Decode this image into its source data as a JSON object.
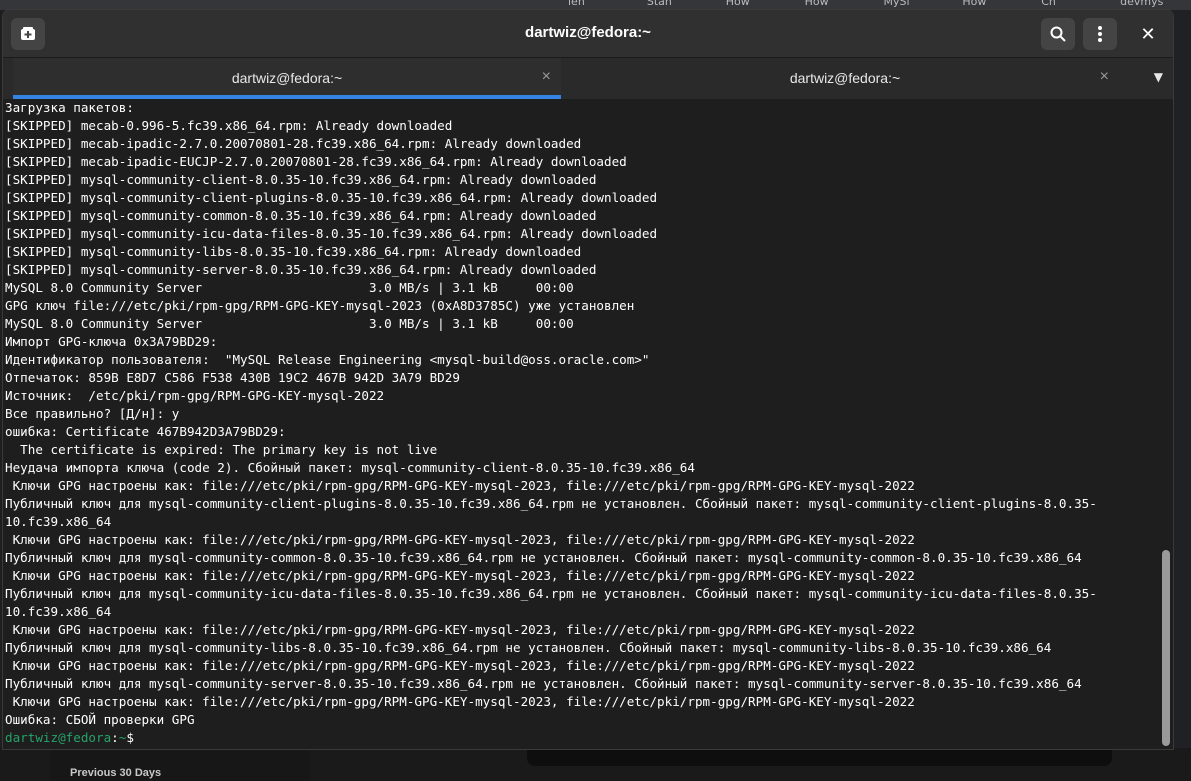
{
  "window": {
    "title": "dartwiz@fedora:~",
    "new_tab_icon": "new-tab-icon",
    "search_icon": "search-icon",
    "menu_icon": "kebab-menu-icon",
    "close_glyph": "✕"
  },
  "tabs": [
    {
      "label": "dartwiz@fedora:~",
      "close": "×",
      "active": true
    },
    {
      "label": "dartwiz@fedora:~",
      "close": "×",
      "active": false
    }
  ],
  "tab_menu_glyph": "▼",
  "background": {
    "browser_tabs": [
      "ien",
      "Stan",
      "How",
      "How",
      "MySi",
      "How",
      "Ch",
      "devmys"
    ],
    "sidebar_label": "Previous 30 Days"
  },
  "terminal": {
    "lines": [
      "Загрузка пакетов:",
      "[SKIPPED] mecab-0.996-5.fc39.x86_64.rpm: Already downloaded",
      "[SKIPPED] mecab-ipadic-2.7.0.20070801-28.fc39.x86_64.rpm: Already downloaded",
      "[SKIPPED] mecab-ipadic-EUCJP-2.7.0.20070801-28.fc39.x86_64.rpm: Already downloaded",
      "[SKIPPED] mysql-community-client-8.0.35-10.fc39.x86_64.rpm: Already downloaded",
      "[SKIPPED] mysql-community-client-plugins-8.0.35-10.fc39.x86_64.rpm: Already downloaded",
      "[SKIPPED] mysql-community-common-8.0.35-10.fc39.x86_64.rpm: Already downloaded",
      "[SKIPPED] mysql-community-icu-data-files-8.0.35-10.fc39.x86_64.rpm: Already downloaded",
      "[SKIPPED] mysql-community-libs-8.0.35-10.fc39.x86_64.rpm: Already downloaded",
      "[SKIPPED] mysql-community-server-8.0.35-10.fc39.x86_64.rpm: Already downloaded",
      "MySQL 8.0 Community Server                      3.0 MB/s | 3.1 kB     00:00",
      "GPG ключ file:///etc/pki/rpm-gpg/RPM-GPG-KEY-mysql-2023 (0xA8D3785C) уже установлен",
      "MySQL 8.0 Community Server                      3.0 MB/s | 3.1 kB     00:00",
      "Импорт GPG-ключа 0x3A79BD29:",
      "Идентификатор пользователя:  \"MySQL Release Engineering <mysql-build@oss.oracle.com>\"",
      "Отпечаток: 859B E8D7 C586 F538 430B 19C2 467B 942D 3A79 BD29",
      "Источник:  /etc/pki/rpm-gpg/RPM-GPG-KEY-mysql-2022",
      "Все правильно? [Д/н]: y",
      "ошибка: Certificate 467B942D3A79BD29:",
      "  The certificate is expired: The primary key is not live",
      "Неудача импорта ключа (code 2). Сбойный пакет: mysql-community-client-8.0.35-10.fc39.x86_64",
      " Ключи GPG настроены как: file:///etc/pki/rpm-gpg/RPM-GPG-KEY-mysql-2023, file:///etc/pki/rpm-gpg/RPM-GPG-KEY-mysql-2022",
      "Публичный ключ для mysql-community-client-plugins-8.0.35-10.fc39.x86_64.rpm не установлен. Сбойный пакет: mysql-community-client-plugins-8.0.35-",
      "10.fc39.x86_64",
      " Ключи GPG настроены как: file:///etc/pki/rpm-gpg/RPM-GPG-KEY-mysql-2023, file:///etc/pki/rpm-gpg/RPM-GPG-KEY-mysql-2022",
      "Публичный ключ для mysql-community-common-8.0.35-10.fc39.x86_64.rpm не установлен. Сбойный пакет: mysql-community-common-8.0.35-10.fc39.x86_64",
      " Ключи GPG настроены как: file:///etc/pki/rpm-gpg/RPM-GPG-KEY-mysql-2023, file:///etc/pki/rpm-gpg/RPM-GPG-KEY-mysql-2022",
      "Публичный ключ для mysql-community-icu-data-files-8.0.35-10.fc39.x86_64.rpm не установлен. Сбойный пакет: mysql-community-icu-data-files-8.0.35-",
      "10.fc39.x86_64",
      " Ключи GPG настроены как: file:///etc/pki/rpm-gpg/RPM-GPG-KEY-mysql-2023, file:///etc/pki/rpm-gpg/RPM-GPG-KEY-mysql-2022",
      "Публичный ключ для mysql-community-libs-8.0.35-10.fc39.x86_64.rpm не установлен. Сбойный пакет: mysql-community-libs-8.0.35-10.fc39.x86_64",
      " Ключи GPG настроены как: file:///etc/pki/rpm-gpg/RPM-GPG-KEY-mysql-2023, file:///etc/pki/rpm-gpg/RPM-GPG-KEY-mysql-2022",
      "Публичный ключ для mysql-community-server-8.0.35-10.fc39.x86_64.rpm не установлен. Сбойный пакет: mysql-community-server-8.0.35-10.fc39.x86_64",
      " Ключи GPG настроены как: file:///etc/pki/rpm-gpg/RPM-GPG-KEY-mysql-2023, file:///etc/pki/rpm-gpg/RPM-GPG-KEY-mysql-2022",
      "Ошибка: СБОЙ проверки GPG"
    ],
    "prompt": {
      "user_host": "dartwiz@fedora",
      "separator": ":",
      "path": "~",
      "symbol": "$"
    }
  },
  "colors": {
    "accent": "#3584e4",
    "prompt_green": "#26a269",
    "terminal_bg": "#1e1e1e"
  }
}
